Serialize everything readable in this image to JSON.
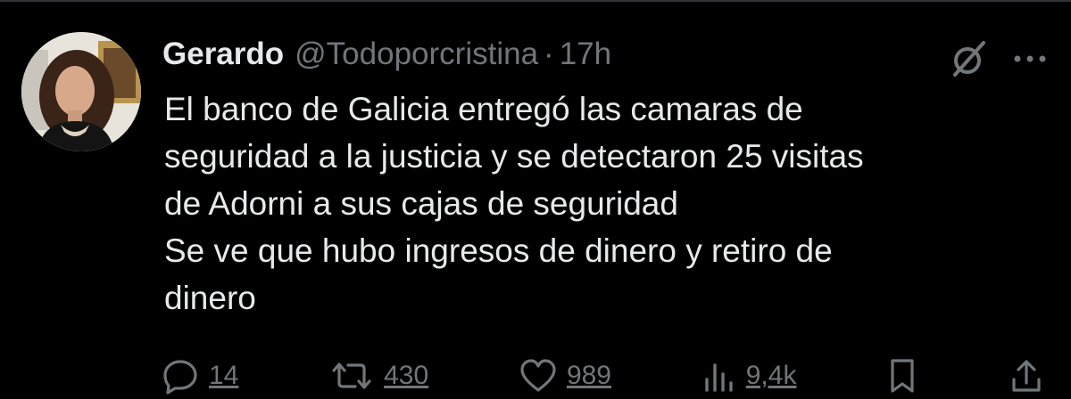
{
  "tweet": {
    "author": {
      "display_name": "Gerardo",
      "handle": "@Todoporcristina",
      "avatar": "profile-photo"
    },
    "separator": "·",
    "time": "17h",
    "text": "El banco de Galicia entregó las camaras de\nseguridad a la justicia y se detectaron 25 visitas\nde Adorni a sus cajas de seguridad\nSe ve que hubo ingresos de dinero y retiro de\ndinero",
    "header_icons": [
      "grok-icon",
      "more-icon"
    ],
    "actions": {
      "replies": "14",
      "reposts": "430",
      "likes": "989",
      "views": "9,4k"
    }
  },
  "colors": {
    "background": "#000000",
    "text_primary": "#e7e9ea",
    "text_secondary": "#71767b",
    "divider": "#2f3336"
  }
}
